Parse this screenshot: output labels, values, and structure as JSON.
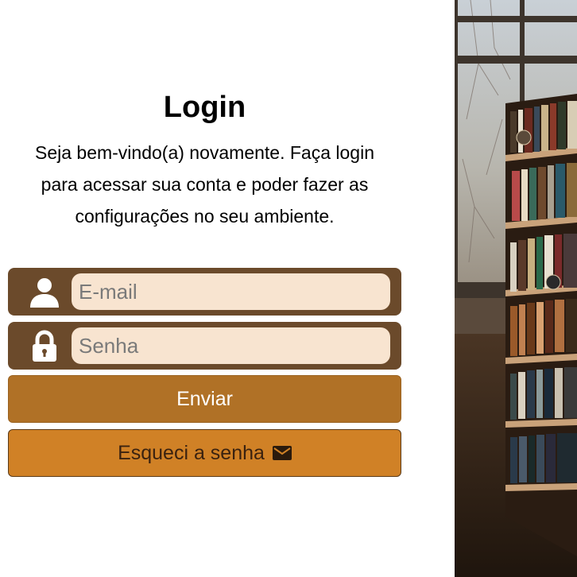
{
  "login": {
    "title": "Login",
    "subtitle": "Seja bem-vindo(a) novamente. Faça login para acessar sua conta e poder fazer as configurações no seu ambiente.",
    "email": {
      "placeholder": "E-mail",
      "value": "",
      "icon": "user-icon"
    },
    "password": {
      "placeholder": "Senha",
      "value": "",
      "icon": "lock-icon"
    },
    "submit_label": "Enviar",
    "forgot_label": "Esqueci a senha",
    "forgot_icon": "mail-icon"
  },
  "colors": {
    "field_bg": "#6b4a2b",
    "input_bg": "#f8e4d0",
    "submit_bg": "#b07126",
    "forgot_bg": "#d08126"
  },
  "side_image": {
    "subject": "library bookshelves by a window"
  }
}
